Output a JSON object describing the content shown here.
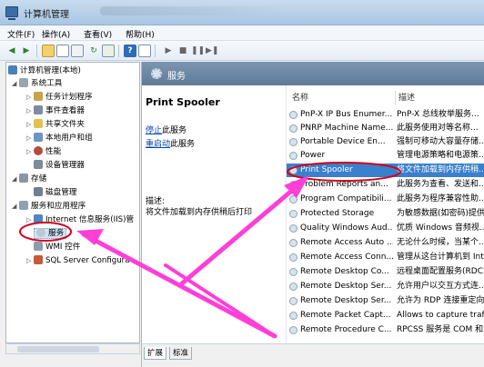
{
  "window": {
    "title": "计算机管理"
  },
  "menu": {
    "file": "文件(F)",
    "action": "操作(A)",
    "view": "查看(V)",
    "help": "帮助(H)"
  },
  "tree": {
    "root": "计算机管理(本地)",
    "system_tools": "系统工具",
    "task_scheduler": "任务计划程序",
    "event_viewer": "事件查看器",
    "shared_folders": "共享文件夹",
    "local_users": "本地用户和组",
    "performance": "性能",
    "device_manager": "设备管理器",
    "storage": "存储",
    "disk_management": "磁盘管理",
    "services_apps": "服务和应用程序",
    "iis": "Internet 信息服务(IIS)管",
    "services": "服务",
    "wmi": "WMI 控件",
    "sql_config": "SQL Server Configura"
  },
  "pane": {
    "header": "服务",
    "service_name": "Print Spooler",
    "stop_link": "停止",
    "stop_suffix": "此服务",
    "restart_link": "重启动",
    "restart_suffix": "此服务",
    "desc_label": "描述:",
    "desc_text": "将文件加载到内存供稍后打印"
  },
  "list": {
    "col_name": "名称",
    "col_desc": "描述",
    "rows": [
      {
        "name": "PnP-X IP Bus Enumer...",
        "desc": "PnP-X 总线枚举服务..."
      },
      {
        "name": "PNRP Machine Name...",
        "desc": "此服务使用对等名称..."
      },
      {
        "name": "Portable Device En...",
        "desc": "强制可移动大容量存储..."
      },
      {
        "name": "Power",
        "desc": "管理电源策略和电源策..."
      },
      {
        "name": "Print Spooler",
        "desc": "将文件加载到内存供稍..."
      },
      {
        "name": "Problem Reports an...",
        "desc": "此服务为查看、发送和..."
      },
      {
        "name": "Program Compatibili...",
        "desc": "此服务为程序兼容性助..."
      },
      {
        "name": "Protected Storage",
        "desc": "为敏感数据(如密码)提供..."
      },
      {
        "name": "Quality Windows Aud...",
        "desc": "优质 Windows 音频视..."
      },
      {
        "name": "Remote Access Auto ...",
        "desc": "无论什么时候，当某个..."
      },
      {
        "name": "Remote Access Conn...",
        "desc": "管理从这台计算机到 Int..."
      },
      {
        "name": "Remote Desktop Co...",
        "desc": "远程桌面配置服务(RDC..."
      },
      {
        "name": "Remote Desktop Ser...",
        "desc": "允许用户以交互方式连..."
      },
      {
        "name": "Remote Desktop Ser...",
        "desc": "允许为 RDP 连接重定向..."
      },
      {
        "name": "Remote Packet Capt...",
        "desc": "Allows to capture traf..."
      },
      {
        "name": "Remote Procedure C...",
        "desc": "RPCSS 服务是 COM 和..."
      }
    ]
  },
  "tabs": {
    "extended": "扩展",
    "standard": "标准"
  },
  "colors": {
    "selected_row": "#3a80cc",
    "annotation": "#ff3fd8",
    "circle": "#d0021b"
  }
}
